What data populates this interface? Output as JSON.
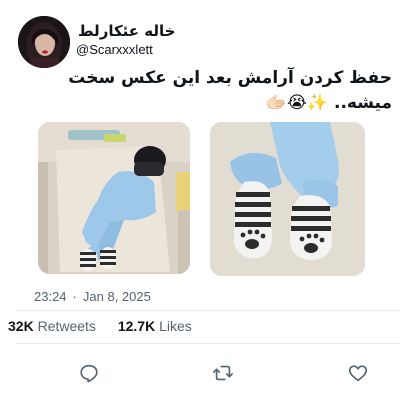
{
  "tweet": {
    "author": {
      "display_name": "خاله عئکارلط",
      "handle": "@Scarxxxlett"
    },
    "text_line1": "حفظ کردن آرامش بعد این عکس سخت",
    "text_line2": "میشه..",
    "text_emojis": "✨😭🫱🏻",
    "time": "23:24",
    "separator": "·",
    "date": "Jan 8, 2025",
    "retweets_count": "32K",
    "retweets_label": "Retweets",
    "likes_count": "12.7K",
    "likes_label": "Likes"
  },
  "icons": {
    "reply": "reply-icon",
    "retweet": "retweet-icon",
    "like": "heart-icon"
  },
  "colors": {
    "text_primary": "#0f1419",
    "text_secondary": "#536471",
    "divider": "#e7ecf0",
    "background": "#ffffff"
  }
}
